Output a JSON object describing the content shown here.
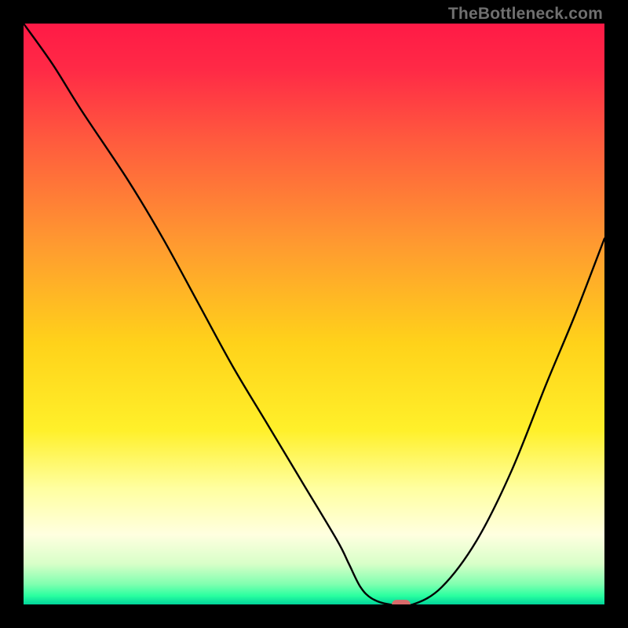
{
  "watermark": "TheBottleneck.com",
  "chart_data": {
    "type": "line",
    "title": "",
    "xlabel": "",
    "ylabel": "",
    "xlim": [
      0,
      100
    ],
    "ylim": [
      0,
      100
    ],
    "background_gradient": {
      "orientation": "vertical",
      "stops": [
        {
          "offset": 0.0,
          "color": "#ff1a46"
        },
        {
          "offset": 0.08,
          "color": "#ff2a46"
        },
        {
          "offset": 0.2,
          "color": "#ff5a3e"
        },
        {
          "offset": 0.38,
          "color": "#ff9a30"
        },
        {
          "offset": 0.55,
          "color": "#ffd21a"
        },
        {
          "offset": 0.7,
          "color": "#fff02a"
        },
        {
          "offset": 0.8,
          "color": "#ffffa0"
        },
        {
          "offset": 0.88,
          "color": "#ffffe0"
        },
        {
          "offset": 0.93,
          "color": "#d8ffc8"
        },
        {
          "offset": 0.965,
          "color": "#80ffb0"
        },
        {
          "offset": 0.985,
          "color": "#2affa0"
        },
        {
          "offset": 1.0,
          "color": "#00d49a"
        }
      ]
    },
    "series": [
      {
        "name": "bottleneck-curve",
        "color": "#000000",
        "x": [
          0,
          5,
          10,
          18,
          24,
          30,
          36,
          42,
          48,
          54,
          56,
          58,
          60,
          63,
          67,
          72,
          78,
          84,
          90,
          95,
          100
        ],
        "y": [
          100,
          93,
          85,
          73,
          63,
          52,
          41,
          31,
          21,
          11,
          7,
          3,
          1,
          0,
          0,
          3,
          11,
          23,
          38,
          50,
          63
        ]
      }
    ],
    "marker": {
      "name": "optimal-point",
      "x": 65,
      "y": 0,
      "color": "#d86a6a",
      "shape": "rounded-rect",
      "width": 3.2,
      "height": 1.6
    }
  }
}
